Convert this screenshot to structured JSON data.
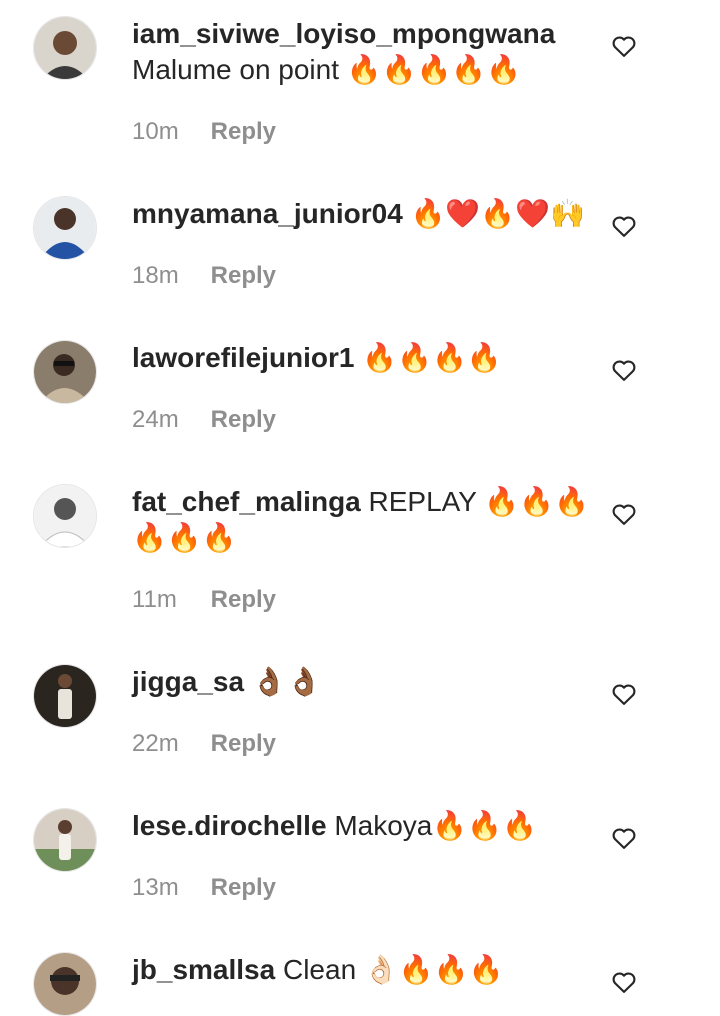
{
  "reply_label": "Reply",
  "comments": [
    {
      "username": "iam_siviwe_loyiso_mpongwana",
      "line1": "",
      "line2": "Malume on point 🔥🔥🔥🔥🔥",
      "time": "10m"
    },
    {
      "username": "mnyamana_junior04",
      "line1": "🔥❤️🔥❤️🙌",
      "line2": "",
      "time": "18m"
    },
    {
      "username": "laworefilejunior1",
      "line1": "🔥🔥🔥🔥",
      "line2": "",
      "time": "24m"
    },
    {
      "username": "fat_chef_malinga",
      "line1": "REPLAY 🔥🔥🔥",
      "line2": "🔥🔥🔥",
      "time": "11m"
    },
    {
      "username": "jigga_sa",
      "line1": "👌🏾👌🏾",
      "line2": "",
      "time": "22m"
    },
    {
      "username": "lese.dirochelle",
      "line1": "Makoya🔥🔥🔥",
      "line2": "",
      "time": "13m"
    },
    {
      "username": "jb_smallsa",
      "line1": "Clean 👌🏻🔥🔥🔥",
      "line2": "",
      "time": ""
    }
  ],
  "colors": {
    "text": "#262626",
    "secondary": "#8e8e8e"
  }
}
